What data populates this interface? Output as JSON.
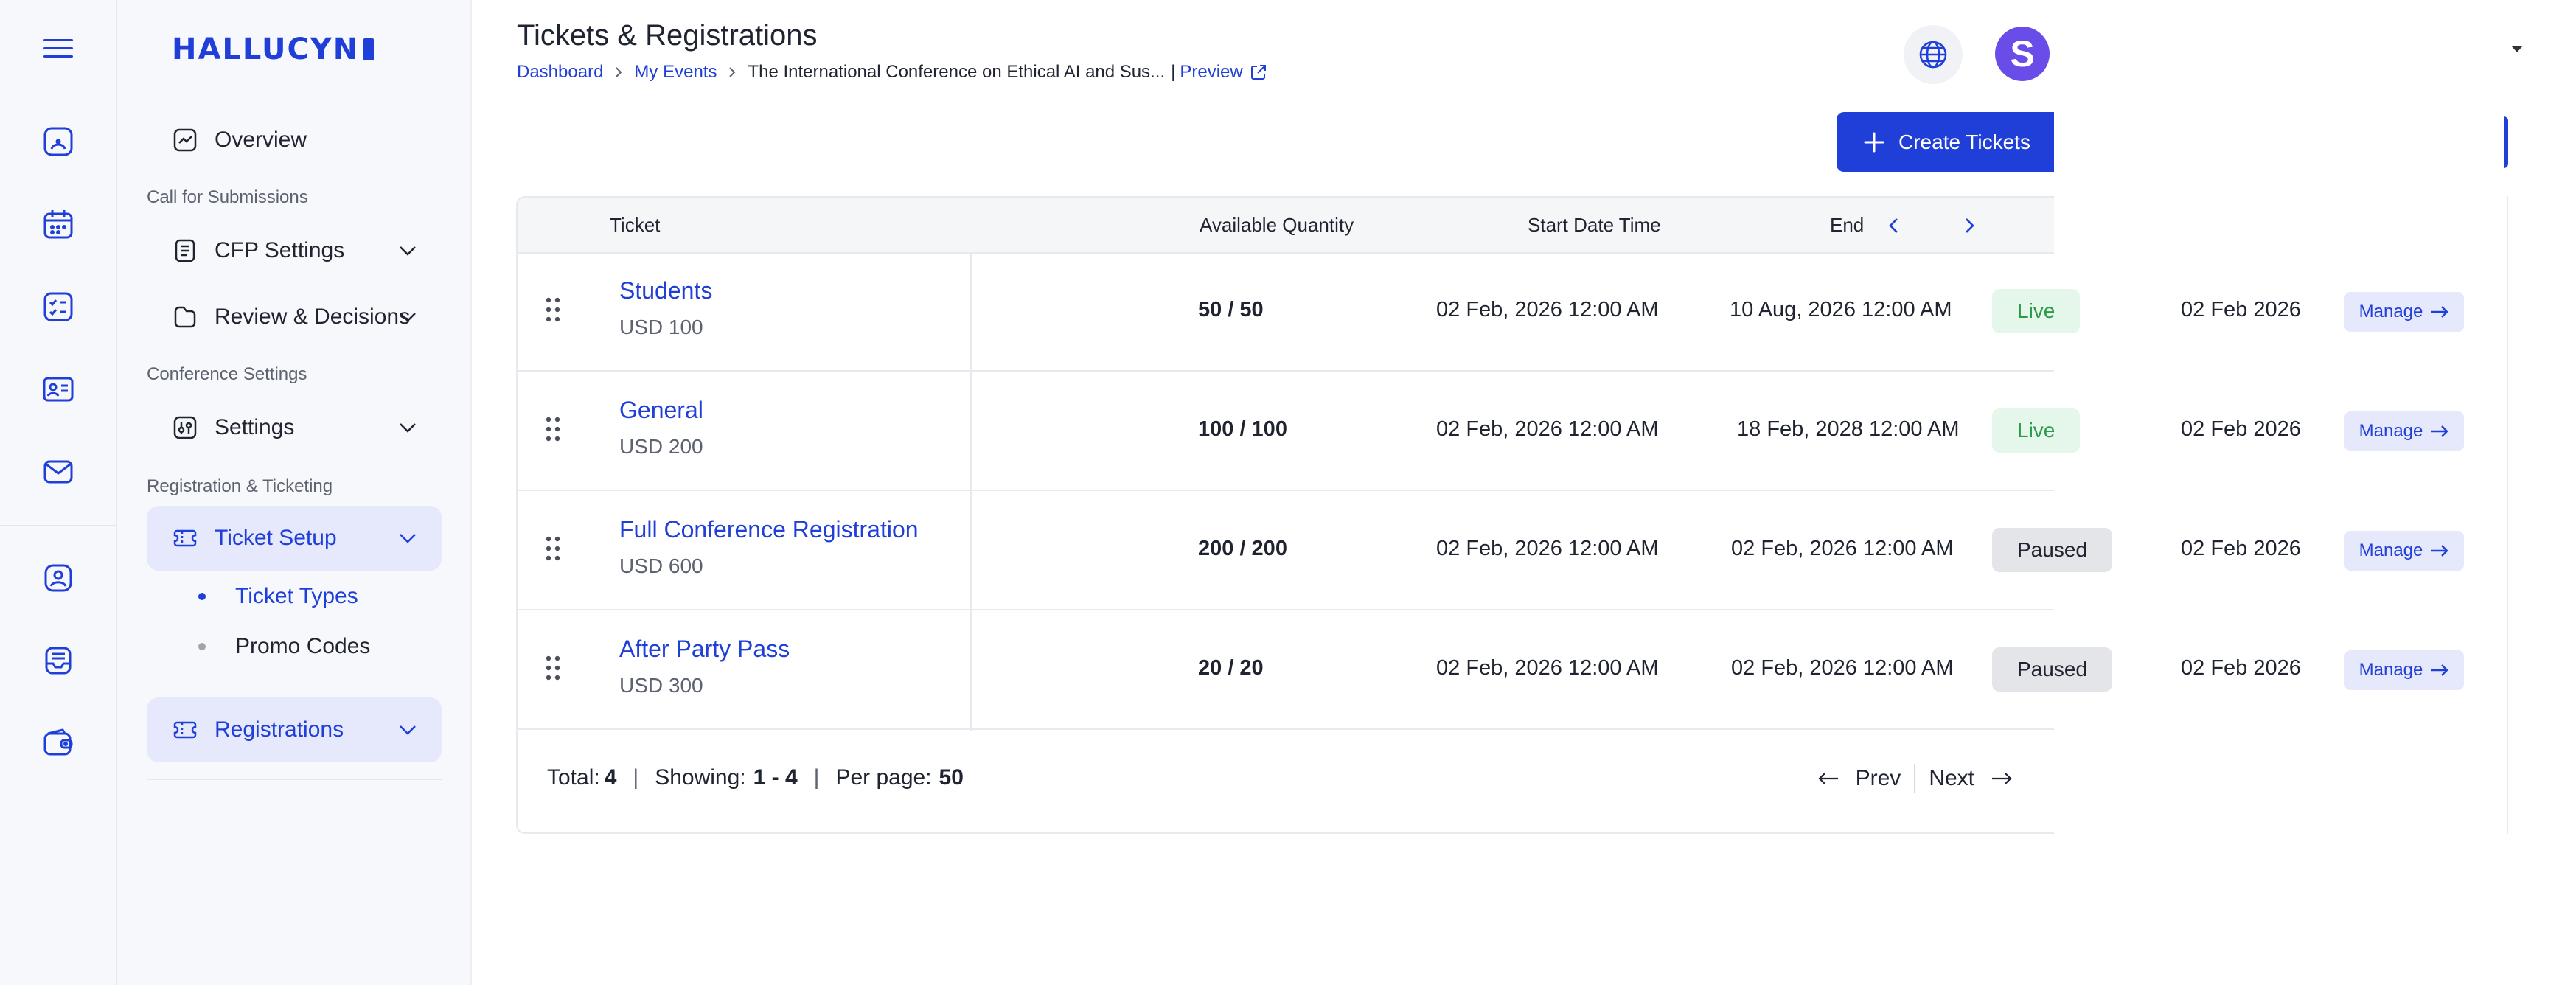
{
  "brand": {
    "logo": "HALLUCYN"
  },
  "rail": {
    "icons": [
      "menu-icon",
      "dashboard-icon",
      "calendar-icon",
      "checklist-icon",
      "contact-card-icon",
      "mail-icon",
      "user-badge-icon",
      "inbox-icon",
      "wallet-icon"
    ]
  },
  "sidebar": {
    "overview": "Overview",
    "section_cfp": "Call for Submissions",
    "cfp_settings": "CFP Settings",
    "review": "Review & Decisions",
    "section_conf": "Conference Settings",
    "settings": "Settings",
    "section_reg": "Registration & Ticketing",
    "ticket_setup": "Ticket Setup",
    "ticket_types": "Ticket Types",
    "promo_codes": "Promo Codes",
    "registrations": "Registrations"
  },
  "header": {
    "title": "Tickets & Registrations",
    "breadcrumb": [
      "Dashboard",
      "My Events",
      "The International Conference on Ethical AI and Sus..."
    ],
    "preview": "Preview",
    "preview_sep": "|",
    "avatar_letter": "S",
    "create_label": "Create Tickets"
  },
  "table": {
    "headers": {
      "ticket": "Ticket",
      "qty": "Available Quantity",
      "start": "Start Date Time",
      "end": "End D"
    },
    "rows": [
      {
        "name": "Students",
        "price": "USD 100",
        "qty": "50 / 50",
        "start": "02 Feb, 2026 12:00 AM",
        "end": "10 Aug, 2026 12:00 AM",
        "status": "Live",
        "created": "02 Feb 2026",
        "action": "Manage"
      },
      {
        "name": "General",
        "price": "USD 200",
        "qty": "100 / 100",
        "start": "02 Feb, 2026 12:00 AM",
        "end": "18 Feb, 2028 12:00 AM",
        "status": "Live",
        "created": "02 Feb 2026",
        "action": "Manage"
      },
      {
        "name": "Full Conference Registration",
        "price": "USD 600",
        "qty": "200 / 200",
        "start": "02 Feb, 2026 12:00 AM",
        "end": "02 Feb, 2026 12:00 AM",
        "status": "Paused",
        "created": "02 Feb 2026",
        "action": "Manage"
      },
      {
        "name": "After Party Pass",
        "price": "USD 300",
        "qty": "20 / 20",
        "start": "02 Feb, 2026 12:00 AM",
        "end": "02 Feb, 2026 12:00 AM",
        "status": "Paused",
        "created": "02 Feb 2026",
        "action": "Manage"
      }
    ],
    "footer": {
      "total_label": "Total:",
      "total": "4",
      "showing_label": "Showing:",
      "showing": "1 - 4",
      "per_page_label": "Per page:",
      "per_page": "50",
      "sep": "|",
      "prev": "Prev",
      "next": "Next"
    }
  },
  "colors": {
    "accent": "#1f3fd8",
    "live_bg": "#e5f6ea",
    "live_text": "#2a9a4a",
    "paused_bg": "#e4e5e8",
    "avatar": "#6a4de8"
  }
}
